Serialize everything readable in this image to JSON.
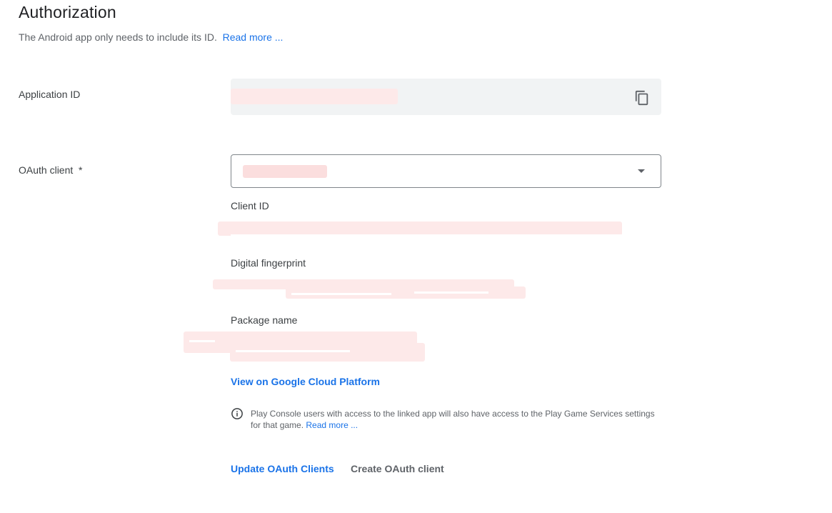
{
  "header": {
    "title": "Authorization",
    "subtitle": "The Android app only needs to include its ID.",
    "read_more": "Read more ..."
  },
  "application_id": {
    "label": "Application ID",
    "copy_icon": "copy-icon"
  },
  "oauth_client": {
    "label": "OAuth client",
    "required_mark": "*",
    "dropdown_icon": "arrow-drop-down-icon"
  },
  "details": {
    "client_id_label": "Client ID",
    "fingerprint_label": "Digital fingerprint",
    "package_label": "Package name"
  },
  "gcp_link": "View on Google Cloud Platform",
  "info": {
    "icon": "info-icon",
    "text": "Play Console users with access to the linked app will also have access to the Play Game Services settings for that game.",
    "read_more": "Read more ..."
  },
  "actions": {
    "update": "Update OAuth Clients",
    "create": "Create OAuth client"
  }
}
